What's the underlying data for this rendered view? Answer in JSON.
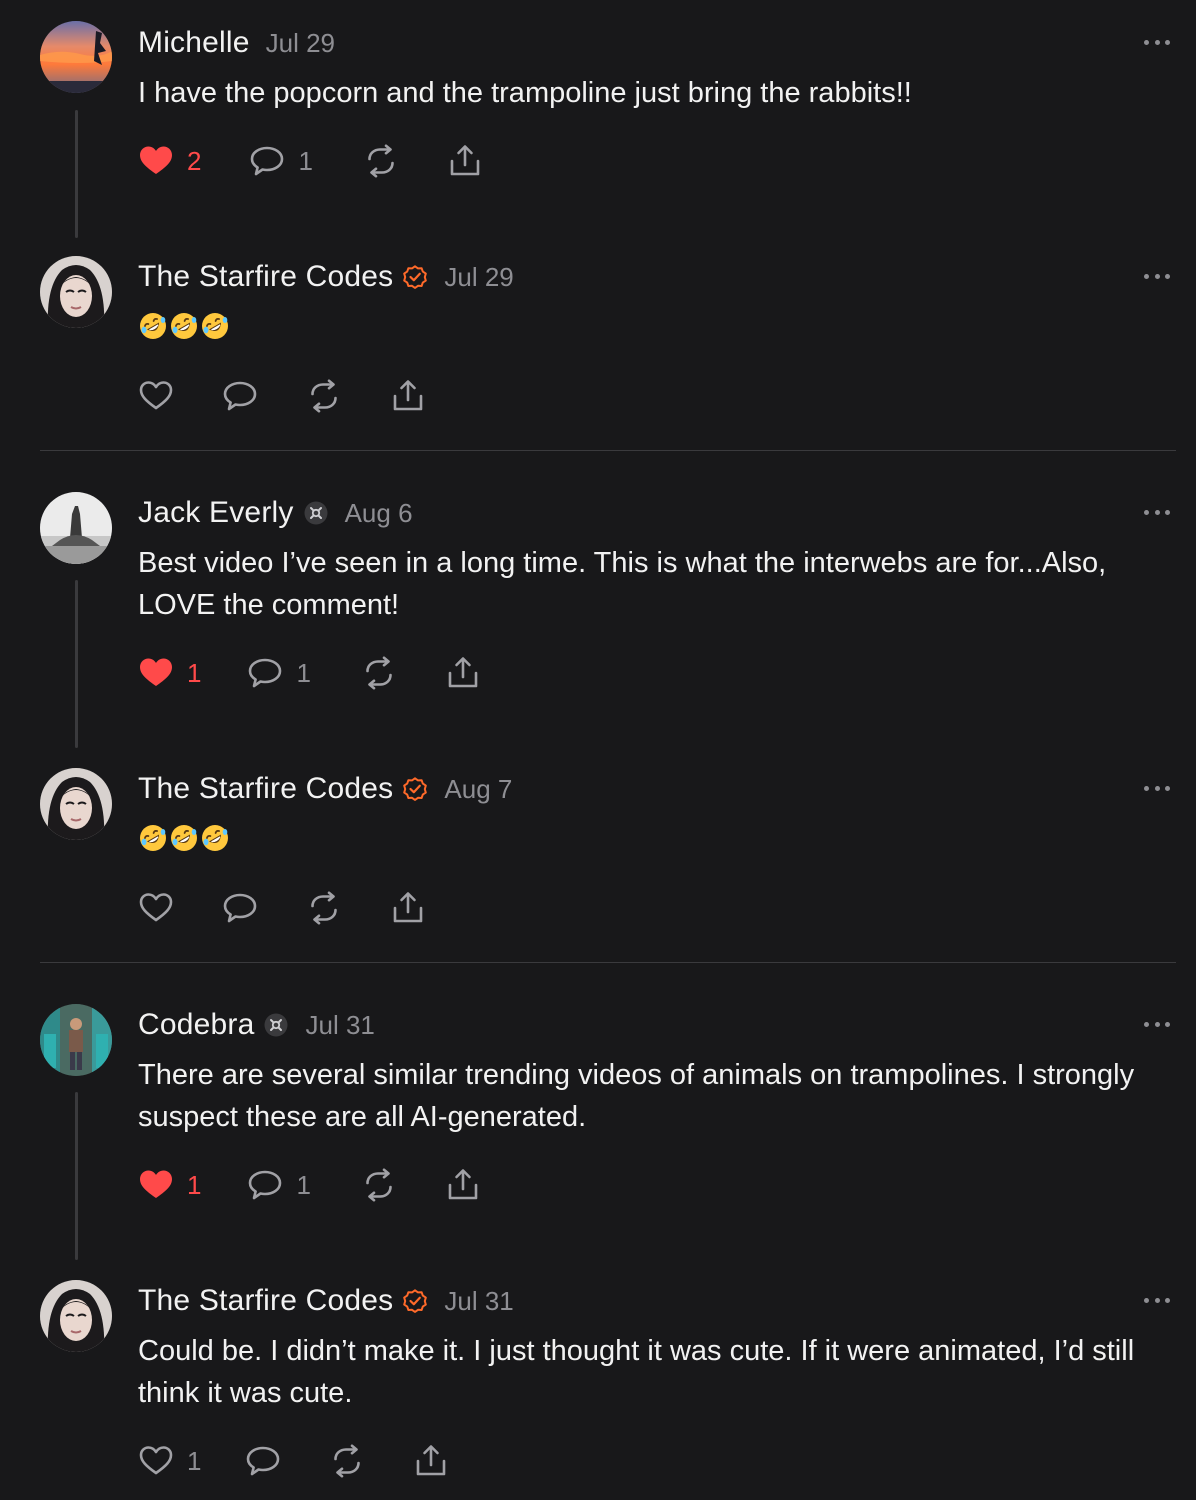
{
  "colors": {
    "background": "#18181a",
    "text": "#f2f2f2",
    "muted": "#8e8e93",
    "like_active": "#ff4a4a",
    "verified_orange": "#ff6a2a",
    "thread_line": "#3a3a3d"
  },
  "comments": [
    {
      "name": "Michelle",
      "date": "Jul 29",
      "text": "I have the popcorn and the trampoline just bring the rabbits!!",
      "likes": "2",
      "replies": "1",
      "liked": true
    },
    {
      "name": "The Starfire Codes",
      "date": "Jul 29",
      "badge": "verified-check-icon",
      "text": "🤣🤣🤣",
      "liked": false
    },
    {
      "name": "Jack Everly",
      "date": "Aug 6",
      "badge": "substack-badge-icon",
      "text": "Best video I’ve seen in a long time. This is what the interwebs are for...Also, LOVE the comment!",
      "likes": "1",
      "replies": "1",
      "liked": true
    },
    {
      "name": "The Starfire Codes",
      "date": "Aug 7",
      "badge": "verified-check-icon",
      "text": "🤣🤣🤣",
      "liked": false
    },
    {
      "name": "Codebra",
      "date": "Jul 31",
      "badge": "substack-badge-icon",
      "text": "There are several similar trending videos of animals on trampolines. I strongly suspect these are all AI-generated.",
      "likes": "1",
      "replies": "1",
      "liked": true
    },
    {
      "name": "The Starfire Codes",
      "date": "Jul 31",
      "badge": "verified-check-icon",
      "text": "Could be. I didn’t make it. I just thought it was cute. If it were animated, I’d still think it was cute.",
      "likes": "1",
      "liked": false
    }
  ]
}
